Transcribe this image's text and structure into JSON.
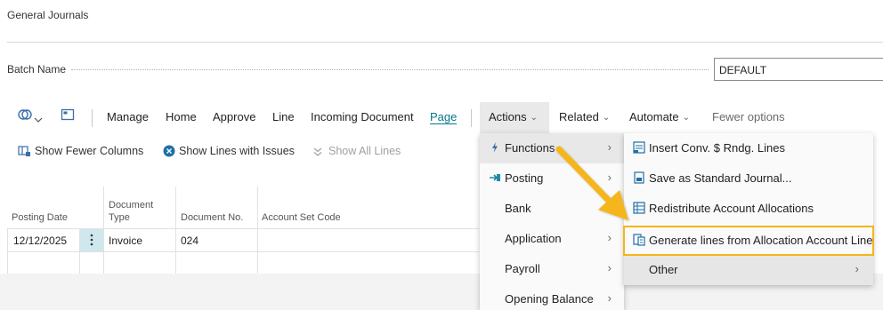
{
  "page": {
    "title": "General Journals"
  },
  "batch": {
    "label": "Batch Name",
    "value": "DEFAULT"
  },
  "toolbar": {
    "icons": [
      "dataverse-icon",
      "dropdown-chevron-icon",
      "open-in-panel-icon"
    ],
    "items": [
      "Manage",
      "Home",
      "Approve",
      "Line",
      "Incoming Document",
      "Page",
      "Actions",
      "Related",
      "Automate",
      "Fewer options"
    ]
  },
  "subtoolbar": {
    "show_fewer_columns": "Show Fewer Columns",
    "show_lines_with_issues": "Show Lines with Issues",
    "show_all_lines": "Show All Lines"
  },
  "table": {
    "headers": {
      "posting_date": "Posting Date",
      "document_type_1": "Document",
      "document_type_2": "Type",
      "document_no": "Document No.",
      "account_set_code": "Account Set Code"
    },
    "rows": [
      {
        "posting_date": "12/12/2025",
        "document_type": "Invoice",
        "document_no": "024",
        "account_set_code": ""
      }
    ]
  },
  "actions_menu": {
    "items": [
      "Functions",
      "Posting",
      "Bank",
      "Application",
      "Payroll",
      "Opening Balance"
    ]
  },
  "functions_submenu": {
    "items": [
      "Insert Conv. $ Rndg. Lines",
      "Save as Standard Journal...",
      "Redistribute Account Allocations",
      "Generate lines from Allocation Account Line",
      "Other"
    ]
  },
  "colors": {
    "accent": "#00788c",
    "highlight": "#f5b51c",
    "arrow": "#f5b51c"
  }
}
